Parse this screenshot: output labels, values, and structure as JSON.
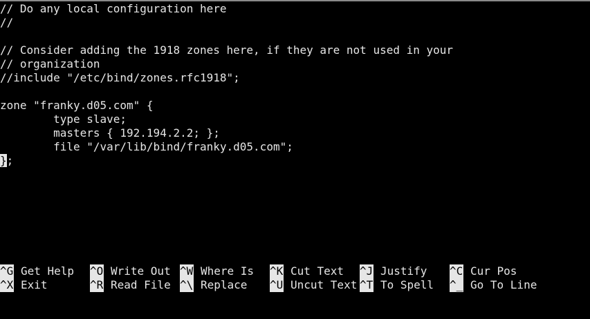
{
  "colors": {
    "background": "#000000",
    "foreground": "#e6e6e6",
    "highlight": "#e6e6e6"
  },
  "editor": {
    "lines": [
      "// Do any local configuration here",
      "//",
      "",
      "// Consider adding the 1918 zones here, if they are not used in your",
      "// organization",
      "//include \"/etc/bind/zones.rfc1918\";",
      "",
      "zone \"franky.d05.com\" {",
      "        type slave;",
      "        masters { 192.194.2.2; };",
      "        file \"/var/lib/bind/franky.d05.com\";",
      "};"
    ],
    "cursor_char": "}",
    "cursor_rest": ";"
  },
  "shortcuts": {
    "row1": [
      {
        "key": "^G",
        "label": "Get Help"
      },
      {
        "key": "^O",
        "label": "Write Out"
      },
      {
        "key": "^W",
        "label": "Where Is"
      },
      {
        "key": "^K",
        "label": "Cut Text"
      },
      {
        "key": "^J",
        "label": "Justify"
      },
      {
        "key": "^C",
        "label": "Cur Pos"
      }
    ],
    "row2": [
      {
        "key": "^X",
        "label": "Exit"
      },
      {
        "key": "^R",
        "label": "Read File"
      },
      {
        "key": "^\\",
        "label": "Replace"
      },
      {
        "key": "^U",
        "label": "Uncut Text"
      },
      {
        "key": "^T",
        "label": "To Spell"
      },
      {
        "key": "^_",
        "label": "Go To Line"
      }
    ]
  }
}
